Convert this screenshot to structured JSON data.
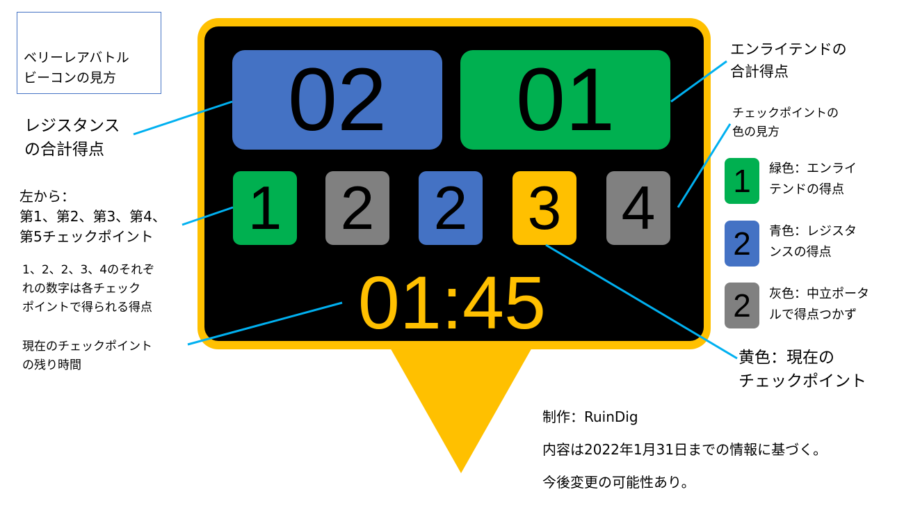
{
  "title": "ベリーレアバトル\nビーコンの見方",
  "annotations": {
    "resistance_total": "レジスタンス\nの合計得点",
    "enlightened_total": "エンライテンドの\n合計得点",
    "checkpoint_color_header": "チェックポイントの\n色の見方",
    "left_order": "左から：\n第1、第2、第3、第4、\n第5チェックポイント",
    "numbers_note": "1、2、2、3、4のそれぞ\nれの数字は各チェック\nポイントで得られる得点",
    "remaining_time": "現在のチェックポイント\nの残り時間",
    "yellow_current": "黄色：現在の\nチェックポイント"
  },
  "scoreboard": {
    "resistance_score": "02",
    "enlightened_score": "01",
    "checkpoints": [
      {
        "value": "1",
        "color": "#00b050"
      },
      {
        "value": "2",
        "color": "#808080"
      },
      {
        "value": "2",
        "color": "#4472c4"
      },
      {
        "value": "3",
        "color": "#ffc000"
      },
      {
        "value": "4",
        "color": "#808080"
      }
    ],
    "timer": "01:45"
  },
  "legend": [
    {
      "value": "1",
      "color": "#00b050",
      "text": "緑色：エンライ\nテンドの得点"
    },
    {
      "value": "2",
      "color": "#4472c4",
      "text": "青色：レジスタ\nンスの得点"
    },
    {
      "value": "2",
      "color": "#808080",
      "text": "灰色：中立ポータ\nルで得点つかず"
    }
  ],
  "credits": {
    "author": "制作：RuinDig",
    "date_note": "内容は2022年1月31日までの情報に基づく。",
    "change_note": "今後変更の可能性あり。"
  },
  "colors": {
    "frame": "#ffc000",
    "screen": "#000000",
    "resistance": "#4472c4",
    "enlightened": "#00b050",
    "neutral": "#808080",
    "current": "#ffc000",
    "callout_line": "#00b0f0"
  }
}
